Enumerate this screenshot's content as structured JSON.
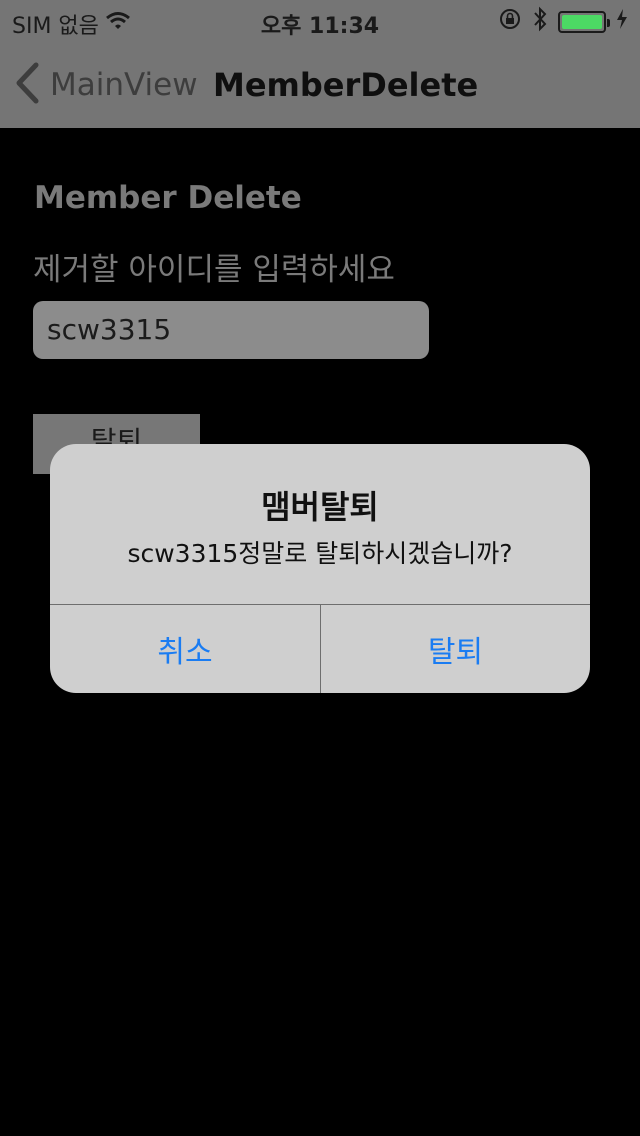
{
  "status_bar": {
    "carrier": "SIM 없음",
    "time": "오후 11:34",
    "battery_color": "#4cd964"
  },
  "nav": {
    "back_label": "MainView",
    "title": "MemberDelete"
  },
  "content": {
    "title": "Member Delete",
    "prompt": "제거할 아이디를 입력하세요",
    "id_value": "scw3315",
    "withdraw_button": "탈퇴"
  },
  "alert": {
    "title": "맴버탈퇴",
    "message": "scw3315정말로 탈퇴하시겠습니까?",
    "cancel": "취소",
    "confirm": "탈퇴",
    "button_color": "#1a7cf2"
  }
}
